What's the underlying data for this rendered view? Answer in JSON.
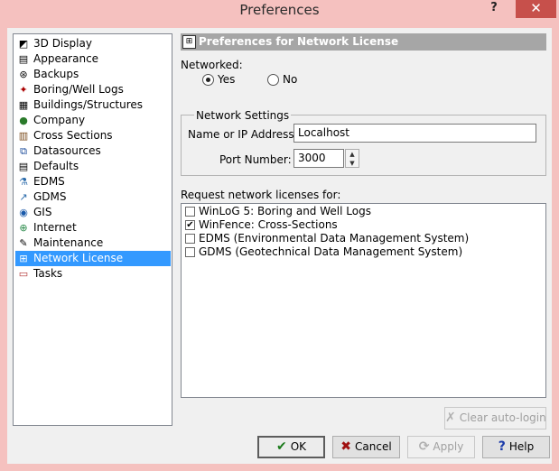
{
  "window": {
    "title": "Preferences",
    "help_glyph": "?",
    "close_glyph": "✕"
  },
  "nav": {
    "items": [
      {
        "label": "3D Display",
        "icon": "3d-display-icon"
      },
      {
        "label": "Appearance",
        "icon": "appearance-icon"
      },
      {
        "label": "Backups",
        "icon": "backups-icon"
      },
      {
        "label": "Boring/Well Logs",
        "icon": "boring-icon"
      },
      {
        "label": "Buildings/Structures",
        "icon": "buildings-icon"
      },
      {
        "label": "Company",
        "icon": "company-icon"
      },
      {
        "label": "Cross Sections",
        "icon": "cross-sections-icon"
      },
      {
        "label": "Datasources",
        "icon": "datasources-icon"
      },
      {
        "label": "Defaults",
        "icon": "defaults-icon"
      },
      {
        "label": "EDMS",
        "icon": "edms-icon"
      },
      {
        "label": "GDMS",
        "icon": "gdms-icon"
      },
      {
        "label": "GIS",
        "icon": "gis-icon"
      },
      {
        "label": "Internet",
        "icon": "internet-icon"
      },
      {
        "label": "Maintenance",
        "icon": "maintenance-icon"
      },
      {
        "label": "Network License",
        "icon": "network-license-icon"
      },
      {
        "label": "Tasks",
        "icon": "tasks-icon"
      }
    ],
    "selected": "Network License"
  },
  "panel": {
    "header": "Preferences for Network License",
    "networked_label": "Networked:",
    "yes_label": "Yes",
    "no_label": "No",
    "networked_value": "Yes",
    "settings_group": "Network Settings",
    "name_label": "Name or IP Address:",
    "name_value": "Localhost",
    "port_label": "Port Number:",
    "port_value": "3000",
    "request_label": "Request network licenses for:",
    "licenses": [
      {
        "label": "WinLoG 5: Boring and Well Logs",
        "checked": false
      },
      {
        "label": "WinFence: Cross-Sections",
        "checked": true
      },
      {
        "label": "EDMS (Environmental Data Management System)",
        "checked": false
      },
      {
        "label": "GDMS (Geotechnical Data Management System)",
        "checked": false
      }
    ],
    "check_glyph": "✔"
  },
  "buttons": {
    "clear_autologin": "Clear auto-login",
    "ok": "OK",
    "cancel": "Cancel",
    "apply": "Apply",
    "help": "Help"
  },
  "colors": {
    "titlebar": "#f5c1bf",
    "close": "#c7504b",
    "selection": "#3399ff",
    "header": "#a6a6a6"
  }
}
